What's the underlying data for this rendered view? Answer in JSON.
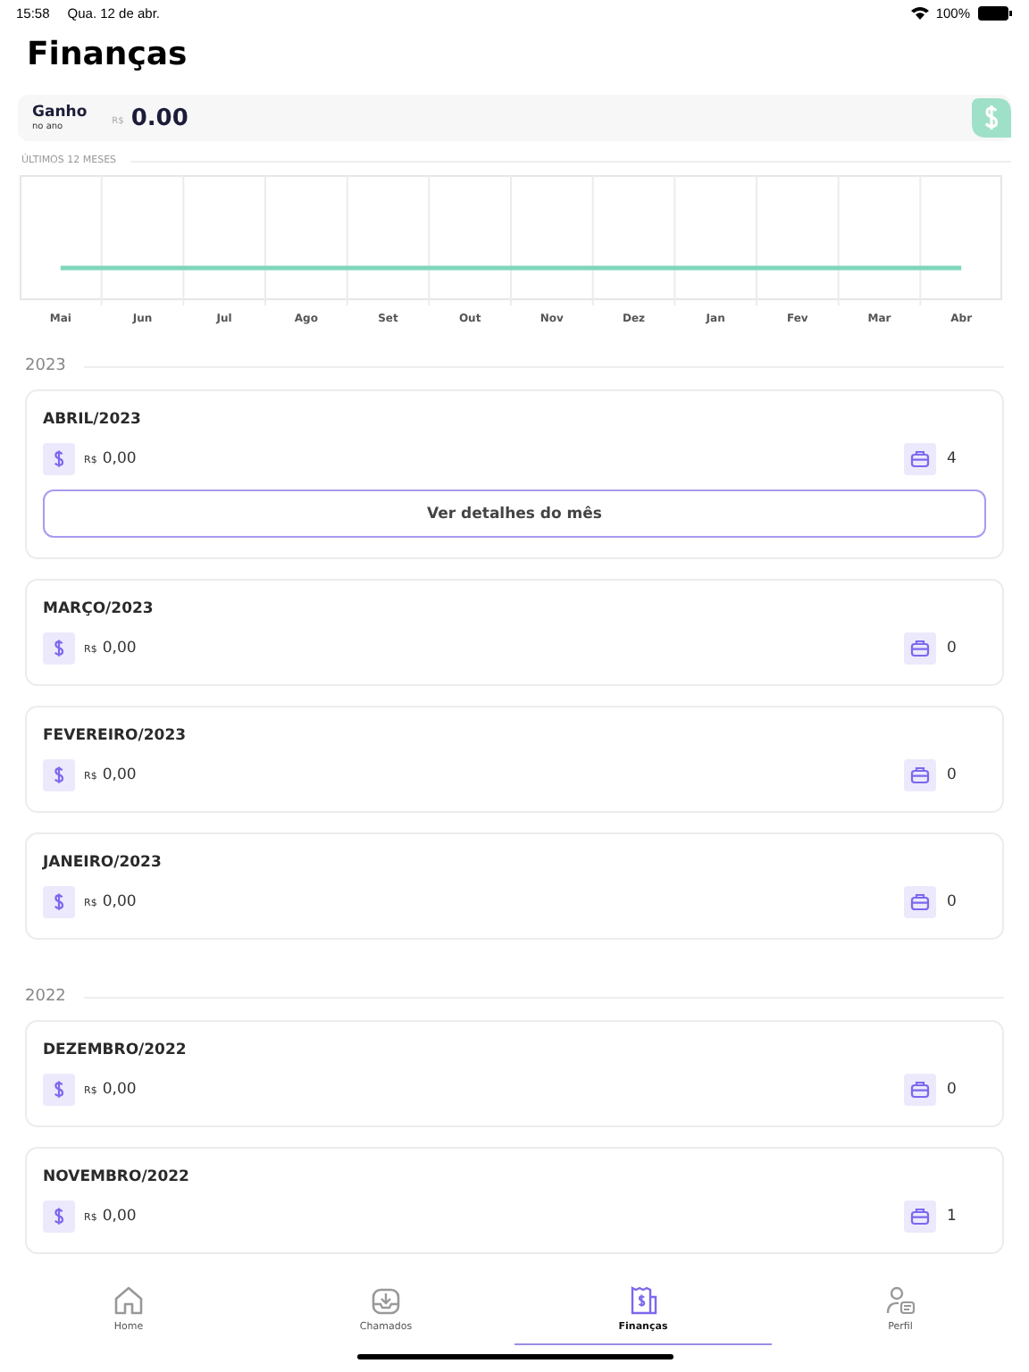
{
  "status_bar": {
    "time": "15:58",
    "date": "Qua. 12 de abr.",
    "battery": "100%"
  },
  "title": "Finanças",
  "summary": {
    "label": "Ganho",
    "sublabel": "no ano",
    "currency": "R$",
    "amount": "0.00"
  },
  "chart": {
    "label": "ÚLTIMOS 12 MESES",
    "months": [
      "Mai",
      "Jun",
      "Jul",
      "Ago",
      "Set",
      "Out",
      "Nov",
      "Dez",
      "Jan",
      "Fev",
      "Mar",
      "Abr"
    ]
  },
  "years": [
    {
      "year": "2023",
      "months": [
        {
          "title": "ABRIL/2023",
          "currency": "R$",
          "amount": "0,00",
          "count": "4",
          "expanded": true,
          "button": "Ver detalhes do mês"
        },
        {
          "title": "MARÇO/2023",
          "currency": "R$",
          "amount": "0,00",
          "count": "0",
          "expanded": false
        },
        {
          "title": "FEVEREIRO/2023",
          "currency": "R$",
          "amount": "0,00",
          "count": "0",
          "expanded": false
        },
        {
          "title": "JANEIRO/2023",
          "currency": "R$",
          "amount": "0,00",
          "count": "0",
          "expanded": false
        }
      ]
    },
    {
      "year": "2022",
      "months": [
        {
          "title": "DEZEMBRO/2022",
          "currency": "R$",
          "amount": "0,00",
          "count": "0",
          "expanded": false
        },
        {
          "title": "NOVEMBRO/2022",
          "currency": "R$",
          "amount": "0,00",
          "count": "1",
          "expanded": false
        }
      ]
    }
  ],
  "tab_bar": [
    {
      "label": "Home",
      "kind": "home",
      "selected": false
    },
    {
      "label": "Chamados",
      "kind": "inbox",
      "selected": false
    },
    {
      "label": "Finanças",
      "kind": "receipt",
      "selected": true
    },
    {
      "label": "Perfil",
      "kind": "profile",
      "selected": false
    }
  ]
}
